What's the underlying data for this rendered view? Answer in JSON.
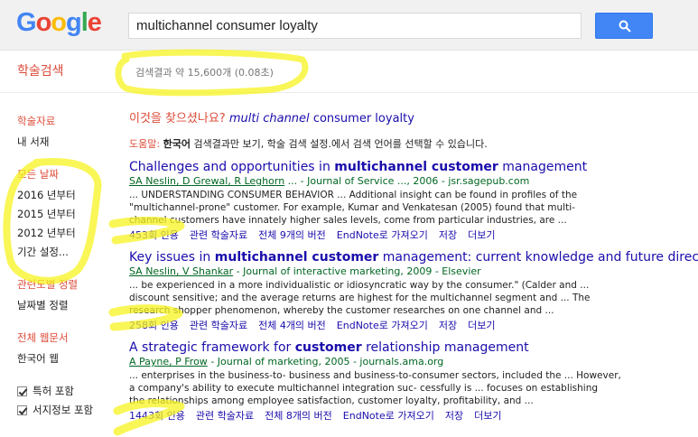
{
  "logo": {
    "letters": [
      "G",
      "o",
      "o",
      "g",
      "l",
      "e"
    ],
    "colors": [
      "#4285f4",
      "#ea4335",
      "#fbbc05",
      "#4285f4",
      "#34a853",
      "#ea4335"
    ]
  },
  "search": {
    "query": "multichannel consumer loyalty",
    "button_icon": "search-icon"
  },
  "header": {
    "scholar_title": "학술검색",
    "result_stats": "검색결과 약 15,600개 (0.08초)"
  },
  "sidebar": {
    "articles_heading": "학술자료",
    "my_library": "내 서재",
    "date_heading": "모든 날짜",
    "date_items": [
      "2016 년부터",
      "2015 년부터",
      "2012 년부터",
      "기간 설정..."
    ],
    "sort_heading": "관련도별 정렬",
    "sort_by_date": "날짜별 정렬",
    "lang_heading": "전체 웹문서",
    "lang_korean": "한국어 웹",
    "include_patents": "특허 포함",
    "include_citations": "서지정보 포함"
  },
  "suggestion": {
    "prefix": "이것을 찾으셨나요?",
    "italic": "multi channel",
    "rest": "consumer loyalty"
  },
  "tip": {
    "label": "도움말:",
    "bold": "한국어",
    "text": "검색결과만 보기, 학술 검색 설정.에서 검색 언어를 선택할 수 있습니다."
  },
  "results": [
    {
      "title_a": "Challenges and opportunities in ",
      "title_b": "multichannel customer",
      "title_c": " management",
      "authors": "SA Neslin, D Grewal, R Leghorn",
      "source": "... - Journal of Service ..., 2006 - jsr.sagepub.com",
      "snippet": [
        "... UNDERSTANDING CONSUMER BEHAVIOR ... Additional insight can be found in profiles of the",
        "\"multichannel-prone\" customer. For example, Kumar and Venkatesan (2005) found that multi-",
        "channel customers have innately higher sales levels, come from particular industries, are ..."
      ],
      "cited": "453회 인용",
      "related": "관련 학술자료",
      "versions": "전체 9개의 버전",
      "endnote": "EndNote로 가져오기",
      "save": "저장",
      "more": "더보기"
    },
    {
      "title_a": "Key issues in ",
      "title_b": "multichannel customer",
      "title_c": " management: current knowledge and future directions",
      "authors": "SA Neslin, V Shankar",
      "source": "- Journal of interactive marketing, 2009 - Elsevier",
      "snippet": [
        "... be experienced in a more individualistic or idiosyncratic way by the consumer.\" (Calder and ...",
        "discount sensitive; and the average returns are highest for the multichannel segment and ... The",
        "research shopper phenomenon, whereby the customer researches on one channel and ..."
      ],
      "cited": "258회 인용",
      "related": "관련 학술자료",
      "versions": "전체 4개의 버전",
      "endnote": "EndNote로 가져오기",
      "save": "저장",
      "more": "더보기"
    },
    {
      "title_a": "A strategic framework for ",
      "title_b": "customer",
      "title_c": " relationship management",
      "authors": "A Payne, P Frow",
      "source": "- Journal of marketing, 2005 - journals.ama.org",
      "snippet": [
        "... enterprises in the business-to- business and business-to-consumer sectors, included the ... However,",
        "a company's ability to execute multichannel integration suc- cessfully is ... focuses on establishing",
        "the relationships among employee satisfaction, customer loyalty, profitability, and ..."
      ],
      "cited": "1443회 인용",
      "related": "관련 학술자료",
      "versions": "전체 8개의 버전",
      "endnote": "EndNote로 가져오기",
      "save": "저장",
      "more": "더보기"
    }
  ],
  "highlight_color": "#f7f31f"
}
